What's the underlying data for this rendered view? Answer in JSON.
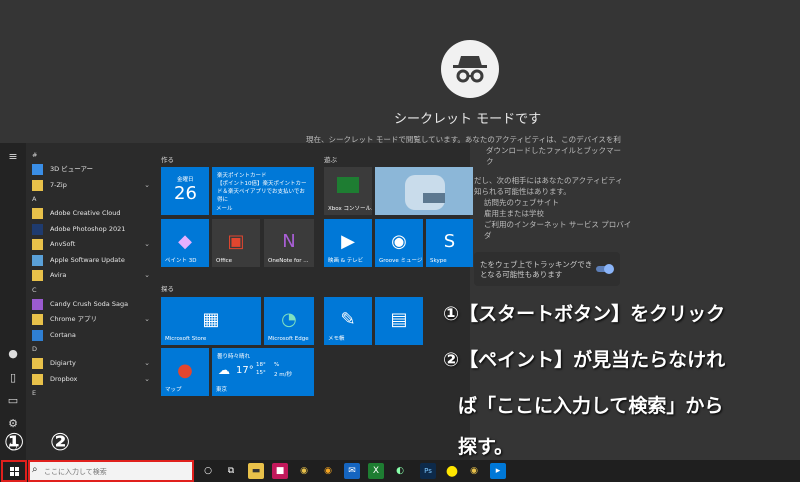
{
  "incognito": {
    "title": "シークレット モードです",
    "paragraph_line1": "現在、シークレット モードで閲覧しています。あなたのアクティビティは、このデバイスを利",
    "paragraph_line2": "ダウンロードしたファイルとブックマーク",
    "list": [
      "だし、次の相手にはあなたのアクティビティ",
      "知られる可能性はあります。",
      "訪問先のウェブサイト",
      "雇用主または学校",
      "ご利用のインターネット サービス プロバイ",
      "ダ"
    ],
    "cookie_text_1": "たをウェブ上でトラッキングでき",
    "cookie_text_2": "となる可能性もあります"
  },
  "start_menu": {
    "apps": [
      {
        "type": "letter",
        "label": "#"
      },
      {
        "type": "app",
        "label": "3D ビューアー",
        "color": "#3a8ee6"
      },
      {
        "type": "app",
        "label": "7-Zip",
        "color": "#e8c14a",
        "expand": true
      },
      {
        "type": "letter",
        "label": "A"
      },
      {
        "type": "app",
        "label": "Adobe Creative Cloud",
        "color": "#e8c14a"
      },
      {
        "type": "app",
        "label": "Adobe Photoshop 2021",
        "color": "#1f3b6e"
      },
      {
        "type": "app",
        "label": "AnvSoft",
        "color": "#e8c14a",
        "expand": true
      },
      {
        "type": "app",
        "label": "Apple Software Update",
        "color": "#5aa0d8"
      },
      {
        "type": "app",
        "label": "Avira",
        "color": "#e8c14a",
        "expand": true
      },
      {
        "type": "letter",
        "label": "C"
      },
      {
        "type": "app",
        "label": "Candy Crush Soda Saga",
        "color": "#9b5bd0"
      },
      {
        "type": "app",
        "label": "Chrome アプリ",
        "color": "#e8c14a",
        "expand": true
      },
      {
        "type": "app",
        "label": "Cortana",
        "color": "#2f7fd3"
      },
      {
        "type": "letter",
        "label": "D"
      },
      {
        "type": "app",
        "label": "Digiarty",
        "color": "#e8c14a",
        "expand": true
      },
      {
        "type": "app",
        "label": "Dropbox",
        "color": "#e8c14a",
        "expand": true
      },
      {
        "type": "letter",
        "label": "E"
      }
    ],
    "groups": {
      "create": "作る",
      "play": "遊ぶ",
      "explore": "探る"
    },
    "tiles": {
      "calendar_day": "金曜日",
      "calendar_date": "26",
      "mail_head": "楽天ポイントカード",
      "mail_body": "【ポイント10倍】楽天ポイントカード＆楽天ペイアプリでお支払いでお得に",
      "mail": "メール",
      "paint3d": "ペイント 3D",
      "office": "Office",
      "onenote": "OneNote for ...",
      "xbox": "Xbox コンソール...",
      "movies": "映画 & テレビ",
      "groove": "Groove ミュージ...",
      "skype": "Skype",
      "store": "Microsoft Store",
      "edge": "Microsoft Edge",
      "memo": "メモ帳",
      "maps": "マップ",
      "weather_desc": "曇り時々晴れ",
      "weather_temp": "17°",
      "weather_hi": "18°",
      "weather_lo": "15°",
      "weather_pct": "%",
      "weather_wind": "2 m/秒",
      "weather_city": "東京"
    }
  },
  "annotations": {
    "line1": "①【スタートボタン】をクリック",
    "line2": "②【ペイント】が見当たらなけれ",
    "line3": "ば「ここに入力して検索」から",
    "line4": "探す。",
    "marker1": "①",
    "marker2": "②"
  },
  "taskbar": {
    "search_placeholder": "ここに入力して検索",
    "accent": "#e0201d"
  }
}
